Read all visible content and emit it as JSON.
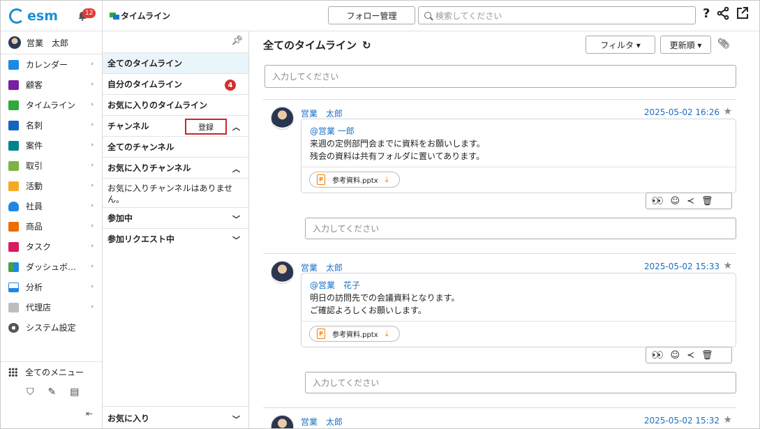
{
  "brand": {
    "logo_text": "esm",
    "notification_count": "12"
  },
  "user": {
    "name": "営業　太郎"
  },
  "sidebar": {
    "items": [
      {
        "label": "カレンダー",
        "icon": "calendar-icon",
        "color": "#1e88e5"
      },
      {
        "label": "顧客",
        "icon": "building-icon",
        "color": "#7b1fa2"
      },
      {
        "label": "タイムライン",
        "icon": "timeline-icon",
        "color": "#2eaa3c"
      },
      {
        "label": "名刺",
        "icon": "card-icon",
        "color": "#1565c0"
      },
      {
        "label": "案件",
        "icon": "folder-icon",
        "color": "#00838f"
      },
      {
        "label": "取引",
        "icon": "deal-icon",
        "color": "#7cb342"
      },
      {
        "label": "活動",
        "icon": "activity-icon",
        "color": "#f9a825"
      },
      {
        "label": "社員",
        "icon": "person-icon",
        "color": "#1e88e5"
      },
      {
        "label": "商品",
        "icon": "product-icon",
        "color": "#ef6c00"
      },
      {
        "label": "タスク",
        "icon": "task-icon",
        "color": "#d81b60"
      },
      {
        "label": "ダッシュボ…",
        "icon": "dashboard-icon",
        "color": "#43a047"
      },
      {
        "label": "分析",
        "icon": "analysis-icon",
        "color": "#1e88e5"
      },
      {
        "label": "代理店",
        "icon": "agency-icon",
        "color": "#bdbdbd"
      },
      {
        "label": "システム設定",
        "icon": "gear-icon",
        "color": "#555555"
      }
    ],
    "all_menu": "全てのメニュー"
  },
  "topbar": {
    "title": "タイムライン",
    "follow_button": "フォロー管理",
    "search_placeholder": "検索してください",
    "help": "?"
  },
  "mid": {
    "all_timeline": "全てのタイムライン",
    "my_timeline": "自分のタイムライン",
    "my_timeline_badge": "4",
    "fav_timeline": "お気に入りのタイムライン",
    "channel": "チャンネル",
    "register": "登録",
    "all_channels": "全てのチャンネル",
    "fav_channels": "お気に入りチャンネル",
    "fav_channels_empty": "お気に入りチャンネルはありません。",
    "joined": "参加中",
    "requests": "参加リクエスト中",
    "favorites": "お気に入り"
  },
  "main": {
    "title": "全てのタイムライン",
    "filter": "フィルタ ▾",
    "sort": "更新順 ▾",
    "input_placeholder": "入力してください",
    "posts": [
      {
        "author": "営業　太郎",
        "date": "2025-05-02 16:26",
        "mention": "@営業 一郎",
        "line1": "来週の定例部門会までに資料をお願いします。",
        "line2": "残会の資料は共有フォルダに置いてあります。",
        "file": "参考資料.pptx",
        "reply_placeholder": "入力してください"
      },
      {
        "author": "営業　太郎",
        "date": "2025-05-02 15:33",
        "mention": "@営業　花子",
        "line1": "明日の訪問先での会議資料となります。",
        "line2": "ご確認よろしくお願いします。",
        "file": "参考資料.pptx",
        "reply_placeholder": "入力してください"
      },
      {
        "author": "営業　太郎",
        "date": "2025-05-02 15:32"
      }
    ]
  }
}
